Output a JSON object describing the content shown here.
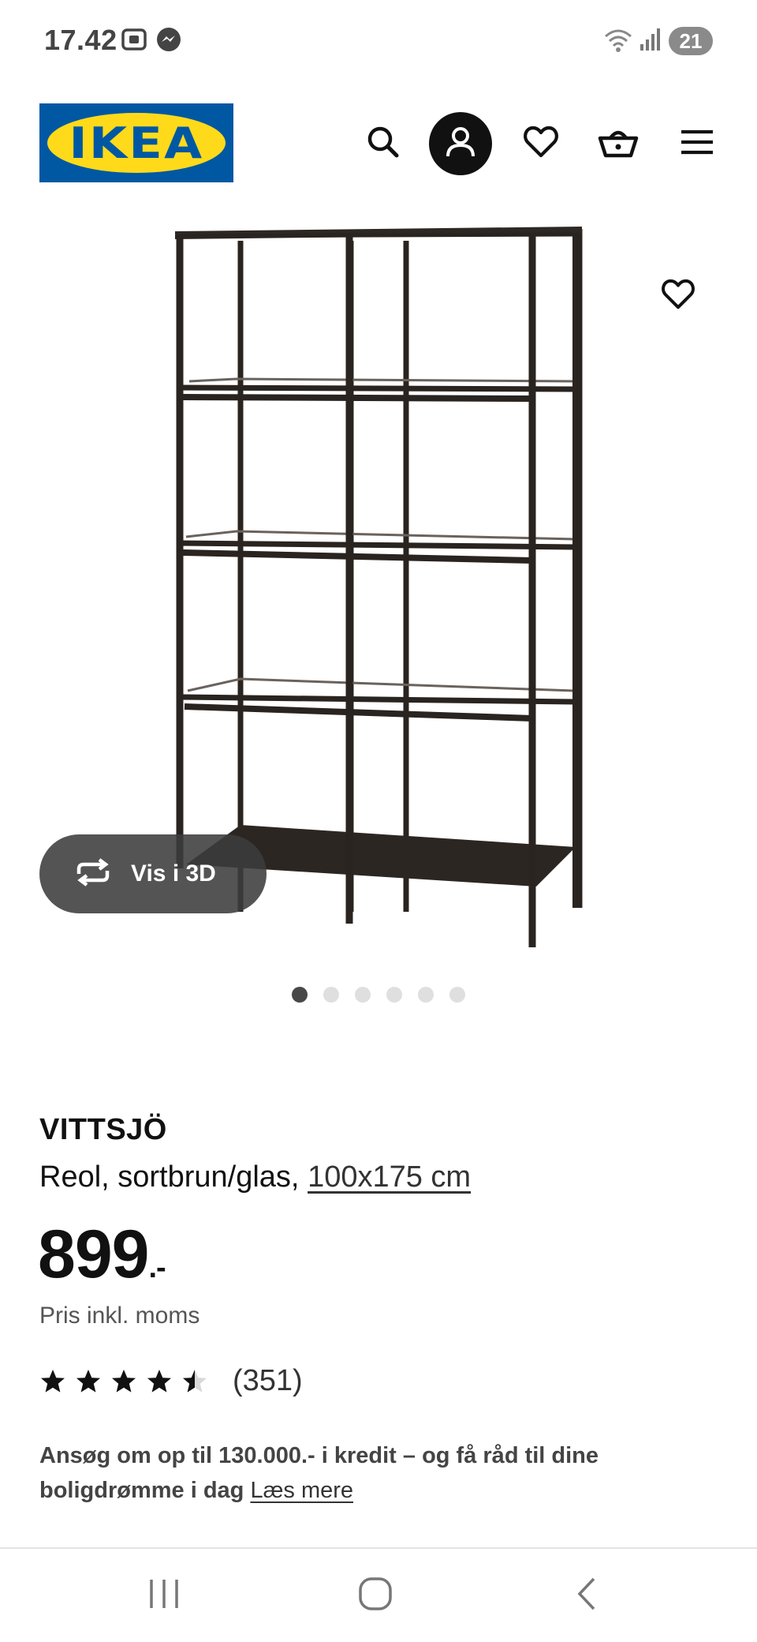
{
  "status_bar": {
    "time": "17.42",
    "icons": [
      "screenshot-icon",
      "messenger-icon",
      "wifi-icon",
      "signal-icon"
    ],
    "battery": "21"
  },
  "header": {
    "logo_text": "IKEA",
    "icons": [
      "search-icon",
      "account-icon",
      "heart-icon",
      "basket-icon",
      "menu-icon"
    ]
  },
  "product_image": {
    "view_3d_label": "Vis i 3D",
    "dots_total": 6,
    "active_dot": 1
  },
  "product": {
    "name": "VITTSJÖ",
    "description": "Reol, sortbrun/glas,",
    "size": "100x175 cm",
    "price": "899",
    "price_suffix": ".-",
    "vat_note": "Pris inkl. moms",
    "rating_value": 4.5,
    "rating_max": 5,
    "review_count": "(351)"
  },
  "credit": {
    "text": "Ansøg om op til 130.000.- i kredit – og få råd til dine boligdrømme i dag",
    "link": "Læs mere"
  },
  "colors": {
    "ikea_blue": "#0058a3",
    "ikea_yellow": "#ffda1a",
    "text_primary": "#111111"
  }
}
